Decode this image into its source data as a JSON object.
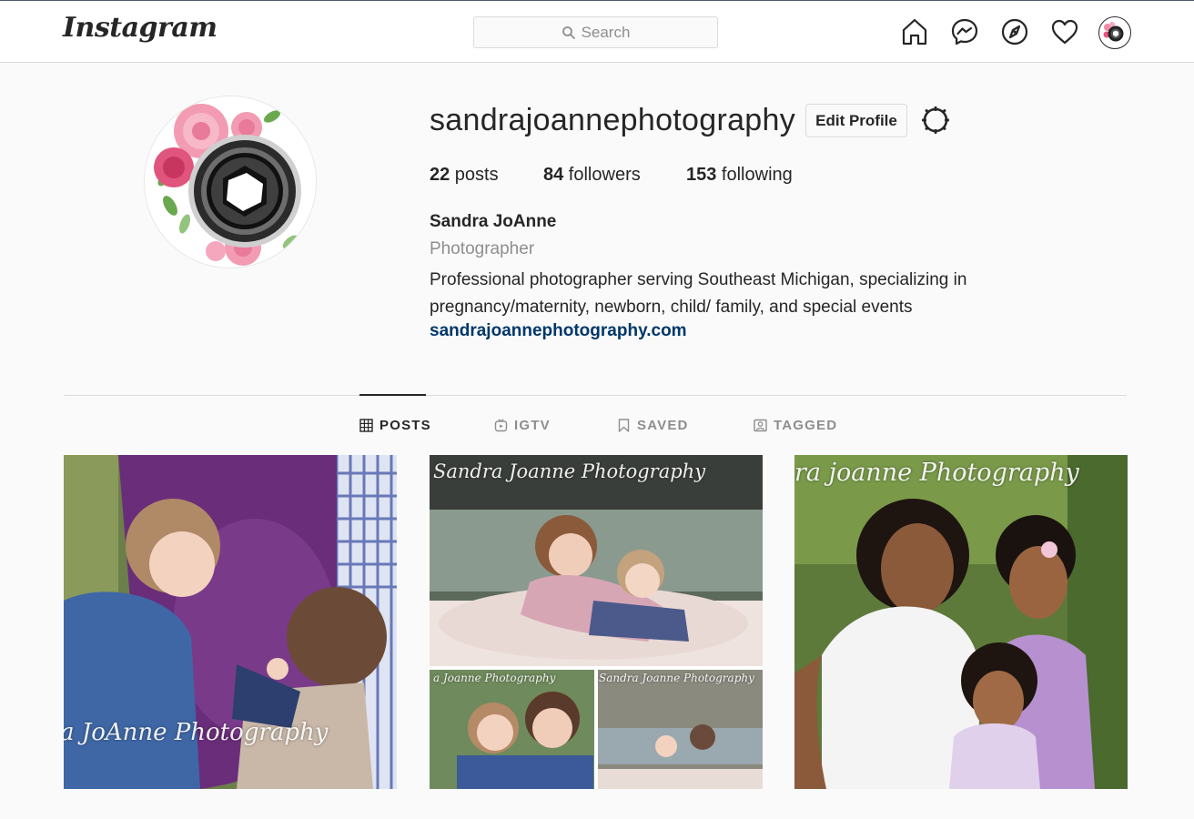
{
  "nav": {
    "logo": "Instagram",
    "search_placeholder": "Search",
    "icons": [
      "home-icon",
      "messenger-icon",
      "explore-icon",
      "activity-heart-icon",
      "profile-avatar-icon"
    ]
  },
  "profile": {
    "username": "sandrajoannephotography",
    "edit_label": "Edit Profile",
    "posts_count": "22",
    "posts_label": " posts",
    "followers_count": "84",
    "followers_label": " followers",
    "following_count": "153",
    "following_label": " following",
    "full_name": "Sandra JoAnne",
    "category": "Photographer",
    "bio_line1": "Professional photographer serving Southeast Michigan, specializing in",
    "bio_line2": "pregnancy/maternity, newborn, child/ family, and special events",
    "website": "sandrajoannephotography.com"
  },
  "tabs": [
    {
      "label": "POSTS",
      "active": true
    },
    {
      "label": "IGTV",
      "active": false
    },
    {
      "label": "SAVED",
      "active": false
    },
    {
      "label": "TAGGED",
      "active": false
    }
  ],
  "posts": [
    {
      "watermark": "a JoAnne Photography"
    },
    {
      "watermark": "Sandra Joanne Photography",
      "sub_watermark_1": "a Joanne Photography",
      "sub_watermark_2": "Sandra Joanne Photography"
    },
    {
      "watermark": "ra joanne Photography"
    }
  ],
  "colors": {
    "link": "#00376b",
    "text": "#262626",
    "muted": "#8e8e8e",
    "border": "#dbdbdb",
    "background": "#fafafa"
  }
}
